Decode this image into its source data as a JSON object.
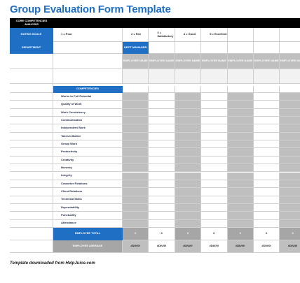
{
  "title": "Group Evaluation Form Template",
  "header": {
    "core_competencies": "CORE COMPETENCIES ANALYSIS",
    "rating_scale_label": "RATING SCALE",
    "ratings": [
      "1 = Poor",
      "2 = Fair",
      "3 = Satisfactory",
      "4 = Good",
      "5 = Excellent"
    ],
    "department_label": "DEPARTMENT",
    "dept_manager": "DEPT MANAGER",
    "employee_name": "EMPLOYEE NAME"
  },
  "competencies_label": "COMPETENCIES",
  "competencies": [
    "Works to Full Potential",
    "Quality of Work",
    "Work Consistency",
    "Communication",
    "Independent Work",
    "Takes Initiative",
    "Group Work",
    "Productivity",
    "Creativity",
    "Honesty",
    "Integrity",
    "Coworker Relations",
    "Client Relations",
    "Technical Skills",
    "Dependability",
    "Punctuality",
    "Attendance"
  ],
  "employee_total_label": "EMPLOYEE TOTAL",
  "employee_average_label": "EMPLOYEE AVERAGE",
  "totals": [
    "0",
    "0",
    "0",
    "0",
    "0",
    "0",
    "0"
  ],
  "averages": [
    "#DIV/0!",
    "#DIV/0!",
    "#DIV/0!",
    "#DIV/0!",
    "#DIV/0!",
    "#DIV/0!",
    "#DIV/0!"
  ],
  "footer": "Template downloaded from HelpJuice.com",
  "colors": {
    "accent": "#1f6fc5",
    "black": "#000000",
    "grey": "#bfbfbf",
    "dark_grey": "#a6a6a6"
  }
}
